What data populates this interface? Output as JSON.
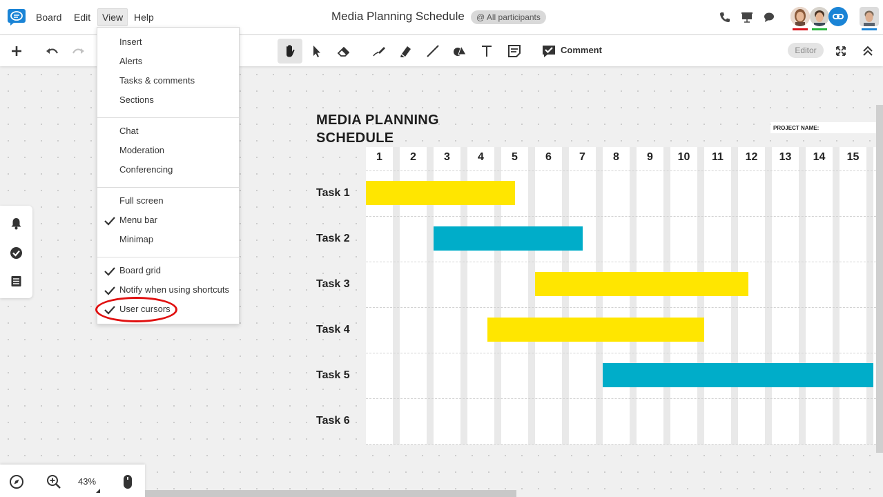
{
  "menubar": {
    "items": [
      "Board",
      "Edit",
      "View",
      "Help"
    ],
    "active": "View"
  },
  "header": {
    "title": "Media Planning Schedule",
    "participants_label": "@ All participants"
  },
  "toolbar": {
    "comment_label": "Comment",
    "role_label": "Editor"
  },
  "view_menu": {
    "sections": [
      [
        {
          "label": "Insert",
          "checked": false
        },
        {
          "label": "Alerts",
          "checked": false
        },
        {
          "label": "Tasks & comments",
          "checked": false
        },
        {
          "label": "Sections",
          "checked": false
        }
      ],
      [
        {
          "label": "Chat",
          "checked": false
        },
        {
          "label": "Moderation",
          "checked": false
        },
        {
          "label": "Conferencing",
          "checked": false
        }
      ],
      [
        {
          "label": "Full screen",
          "checked": false
        },
        {
          "label": "Menu bar",
          "checked": true
        },
        {
          "label": "Minimap",
          "checked": false
        }
      ],
      [
        {
          "label": "Board grid",
          "checked": true
        },
        {
          "label": "Notify when using shortcuts",
          "checked": true
        },
        {
          "label": "User cursors",
          "checked": true
        }
      ]
    ]
  },
  "board": {
    "title_line1": "MEDIA PLANNING",
    "title_line2": "SCHEDULE",
    "project_name_label": "PROJECT NAME:",
    "columns": [
      "1",
      "2",
      "3",
      "4",
      "5",
      "6",
      "7",
      "8",
      "9",
      "10",
      "11",
      "12",
      "13",
      "14",
      "15"
    ],
    "tasks": [
      {
        "label": "Task 1",
        "start": 1,
        "end": 5.4,
        "color": "#ffe600"
      },
      {
        "label": "Task 2",
        "start": 3,
        "end": 7.4,
        "color": "#00adc9"
      },
      {
        "label": "Task 3",
        "start": 6,
        "end": 12.3,
        "color": "#ffe600"
      },
      {
        "label": "Task 4",
        "start": 4.6,
        "end": 11.0,
        "color": "#ffe600"
      },
      {
        "label": "Task 5",
        "start": 8,
        "end": 16,
        "color": "#00adc9"
      },
      {
        "label": "Task 6",
        "start": null,
        "end": null,
        "color": null
      }
    ]
  },
  "bottom": {
    "zoom_label": "43%"
  },
  "colors": {
    "brand_blue": "#1a84d6",
    "highlight_red": "#e01010",
    "bar_yellow": "#ffe600",
    "bar_teal": "#00adc9"
  }
}
